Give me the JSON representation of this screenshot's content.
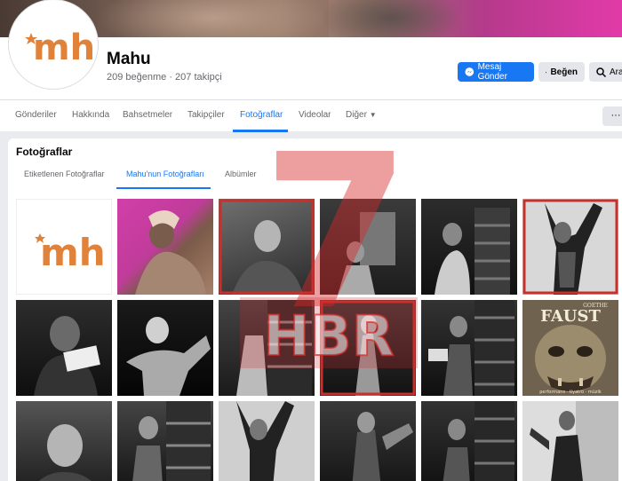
{
  "page": {
    "name": "Mahu",
    "stats": "209 beğenme · 207 takipçi",
    "logo_text": "mh"
  },
  "header_buttons": {
    "message": "Mesaj Gönder",
    "like": "Beğen",
    "search": "Ara"
  },
  "tabs": [
    "Gönderiler",
    "Hakkında",
    "Bahsetmeler",
    "Takipçiler",
    "Fotoğraflar",
    "Videolar",
    "Diğer"
  ],
  "tabs_more": "···",
  "photos_section": {
    "title": "Fotoğraflar",
    "subtabs": [
      "Etiketlenen Fotoğraflar",
      "Mahu'nun Fotoğrafları",
      "Albümler"
    ],
    "active_subtab": "Mahu'nun Fotoğrafları"
  },
  "poster": {
    "title": "FAUST",
    "top": "GOETHE",
    "bottom": "performans · tiyatro · müzik"
  },
  "watermark": {
    "text": "HBR",
    "numeral": "7"
  },
  "colors": {
    "accent": "#1877f2",
    "logo": "#e1823a",
    "watermark": "#d6292a"
  }
}
